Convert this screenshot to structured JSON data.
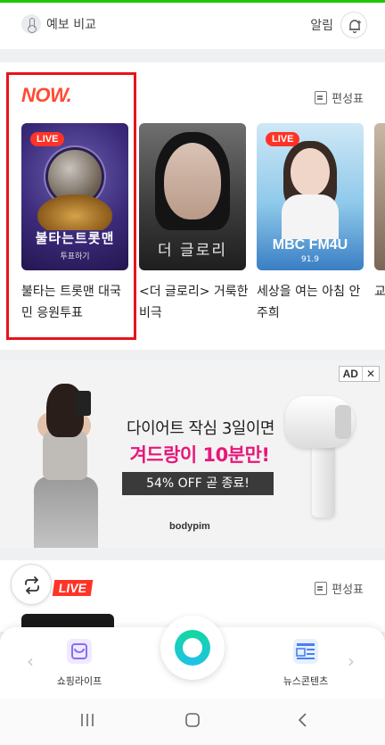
{
  "top_bar": {
    "weather_label": "예보 비교",
    "alarm_label": "알림"
  },
  "now_section": {
    "logo": "NOW.",
    "schedule_label": "편성표",
    "items": [
      {
        "live_badge": "LIVE",
        "thumb_title": "불타는트롯맨",
        "thumb_sub": "투표하기",
        "caption": "불타는 트롯맨 대국민 응원투표"
      },
      {
        "live_badge": "",
        "thumb_title": "더 글로리",
        "caption": "<더 글로리> 거룩한비극"
      },
      {
        "live_badge": "LIVE",
        "thumb_title": "MBC FM4U",
        "thumb_sub": "91.9",
        "caption": "세상을 여는 아침 안주희"
      },
      {
        "caption": "교"
      }
    ]
  },
  "ad": {
    "badge": "AD",
    "close": "✕",
    "line1": "다이어트 작심 3일이면",
    "line2": "겨드랑이 10분만!",
    "offer": "54% OFF 곧 종료!",
    "brand": "bodypim"
  },
  "live_section": {
    "tag": "LIVE",
    "schedule_label": "편성표"
  },
  "dock": {
    "left_item": "쇼핑라이프",
    "right_item": "뉴스콘텐츠"
  },
  "colors": {
    "now_logo": "#ff4b33",
    "live_red": "#ff3326",
    "highlight_box": "#e8131b",
    "ad_pink": "#e8177a",
    "green_button": "#12d8a0"
  }
}
